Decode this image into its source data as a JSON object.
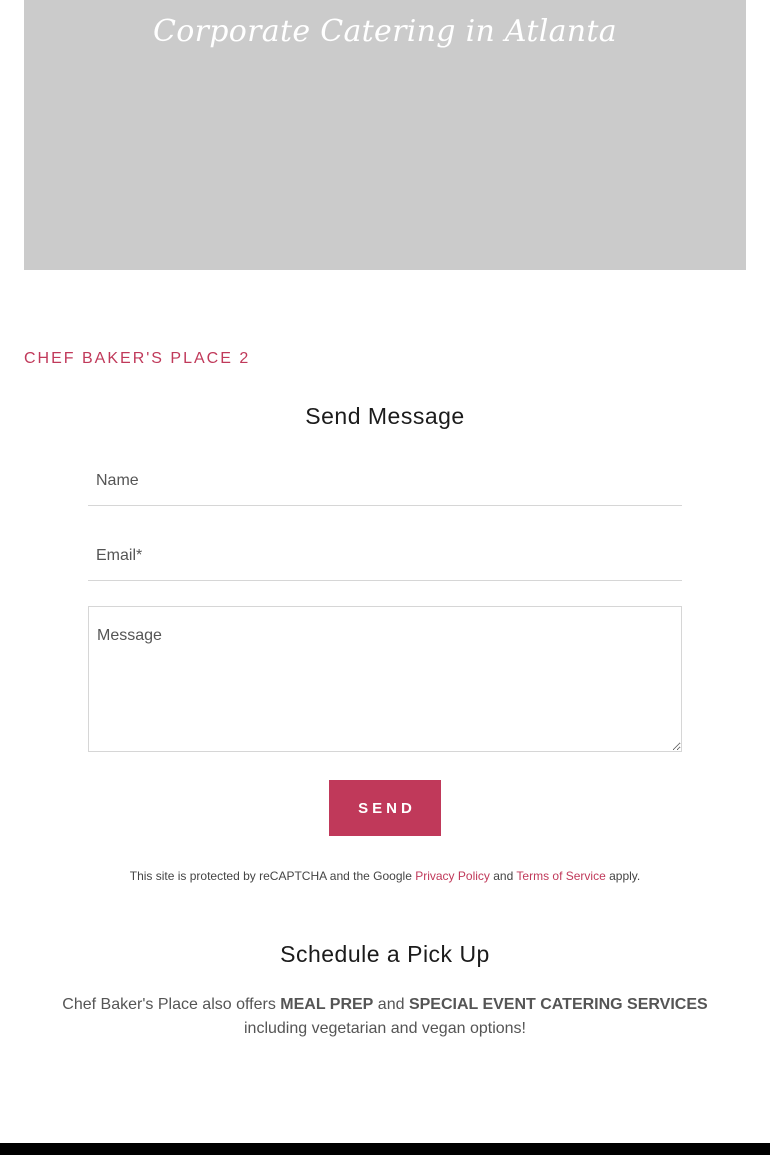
{
  "hero": {
    "title": "Corporate Catering in Atlanta",
    "background_color": "#cbcbcb"
  },
  "business_name": "CHEF BAKER'S PLACE 2",
  "contact_form": {
    "heading": "Send Message",
    "name_placeholder": "Name",
    "email_placeholder": "Email*",
    "message_placeholder": "Message",
    "send_label": "SEND"
  },
  "recaptcha": {
    "prefix": "This site is protected by reCAPTCHA and the Google",
    "privacy_link": "Privacy Policy",
    "and": "and",
    "terms_link": "Terms of Service",
    "suffix": "apply."
  },
  "pickup": {
    "heading": "Schedule a Pick Up",
    "text_prefix": "Chef Baker's Place also offers",
    "meal_prep": "MEAL PREP",
    "and": "and",
    "catering": "SPECIAL EVENT CATERING SERVICES",
    "text_suffix": "including vegetarian and vegan options!"
  },
  "colors": {
    "accent": "#c0395a",
    "heading": "#1b1b1b",
    "body_text": "#555555",
    "footer": "#000000"
  }
}
